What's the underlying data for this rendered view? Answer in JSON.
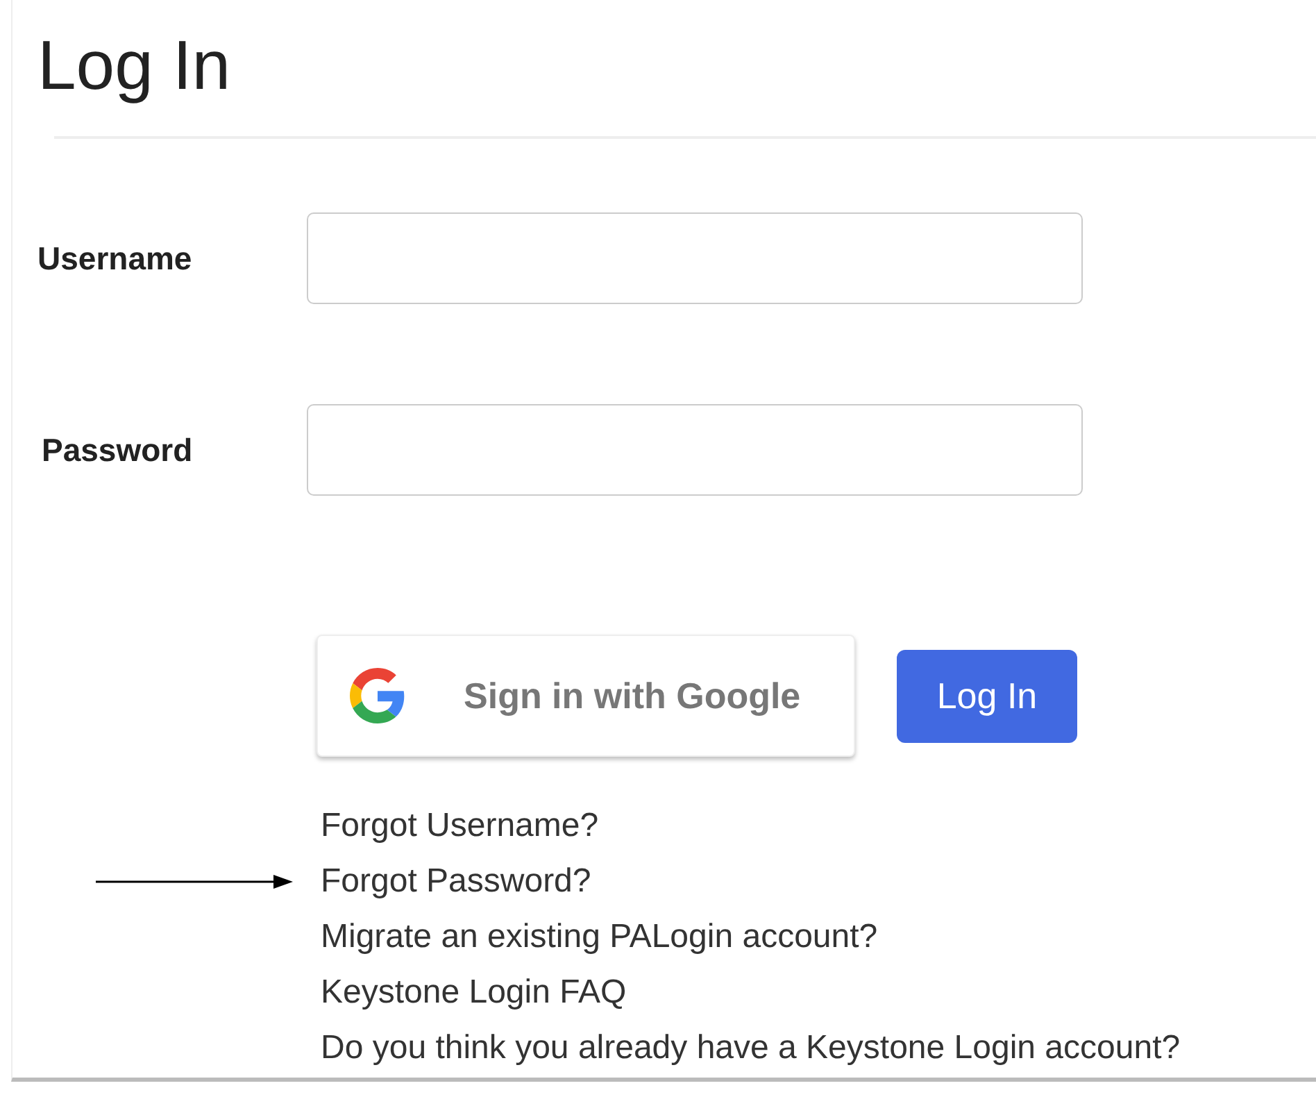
{
  "title": "Log In",
  "fields": [
    {
      "label": "Username"
    },
    {
      "label": "Password"
    }
  ],
  "buttons": [
    {
      "kind": "google",
      "label": "Sign in with Google"
    },
    {
      "kind": "primary",
      "label": "Log In"
    }
  ],
  "links": [
    {
      "label": "Forgot Username?",
      "arrow": false
    },
    {
      "label": "Forgot Password?",
      "arrow": true
    },
    {
      "label": "Migrate an existing PALogin account?",
      "arrow": false
    },
    {
      "label": "Keystone Login FAQ",
      "arrow": false
    },
    {
      "label": "Do you think you already have a Keystone Login account?",
      "arrow": false
    }
  ]
}
